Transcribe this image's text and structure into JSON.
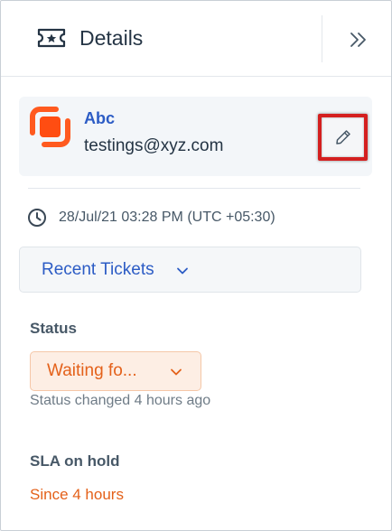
{
  "header": {
    "title": "Details",
    "ticket_icon": "ticket-star-icon",
    "collapse_icon": "double-chevron-right-icon"
  },
  "contact": {
    "name": "Abc",
    "email": "testings@xyz.com",
    "logo_icon": "contact-logo-icon",
    "edit_icon": "pencil-icon"
  },
  "ticket": {
    "created_at": "28/Jul/21 03:28 PM (UTC +05:30)",
    "clock_icon": "clock-icon"
  },
  "recent_tickets": {
    "label": "Recent Tickets"
  },
  "status": {
    "label": "Status",
    "value": "Waiting fo...",
    "changed_text": "Status changed 4 hours ago"
  },
  "sla": {
    "label": "SLA on hold",
    "value": "Since 4 hours"
  },
  "colors": {
    "accent": "#2c5cc5",
    "status_orange": "#e4611a",
    "highlight_red": "#d41f1f"
  }
}
